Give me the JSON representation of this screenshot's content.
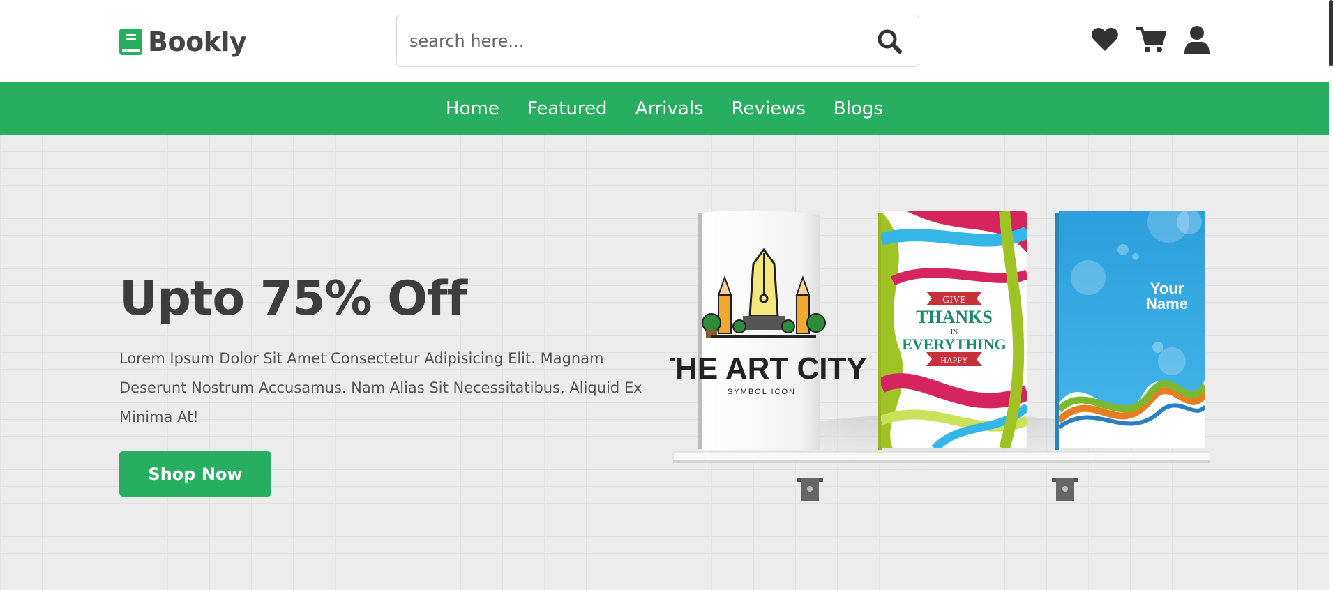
{
  "brand": {
    "name": "Bookly",
    "icon": "book-icon",
    "color": "#27ae60"
  },
  "search": {
    "placeholder": "search here...",
    "icon": "search-icon"
  },
  "header_icons": [
    "heart-icon",
    "cart-icon",
    "user-icon"
  ],
  "nav": {
    "items": [
      {
        "label": "Home"
      },
      {
        "label": "Featured"
      },
      {
        "label": "Arrivals"
      },
      {
        "label": "Reviews"
      },
      {
        "label": "Blogs"
      }
    ]
  },
  "hero": {
    "title": "Upto 75% Off",
    "description": "Lorem Ipsum Dolor Sit Amet Consectetur Adipisicing Elit. Magnam Deserunt Nostrum Accusamus. Nam Alias Sit Necessitatibus, Aliquid Ex Minima At!",
    "button_label": "Shop Now"
  },
  "books": [
    {
      "title": "THE ART CITY",
      "subtitle": "SYMBOL ICON"
    },
    {
      "line1": "GIVE",
      "line2": "THANKS",
      "line3": "IN",
      "line4": "EVERYTHING",
      "line5": "HAPPY"
    },
    {
      "line1": "Your",
      "line2": "Name"
    }
  ],
  "colors": {
    "accent": "#27ae60",
    "text_dark": "#3d3d3d",
    "hero_bg": "#ececec"
  }
}
